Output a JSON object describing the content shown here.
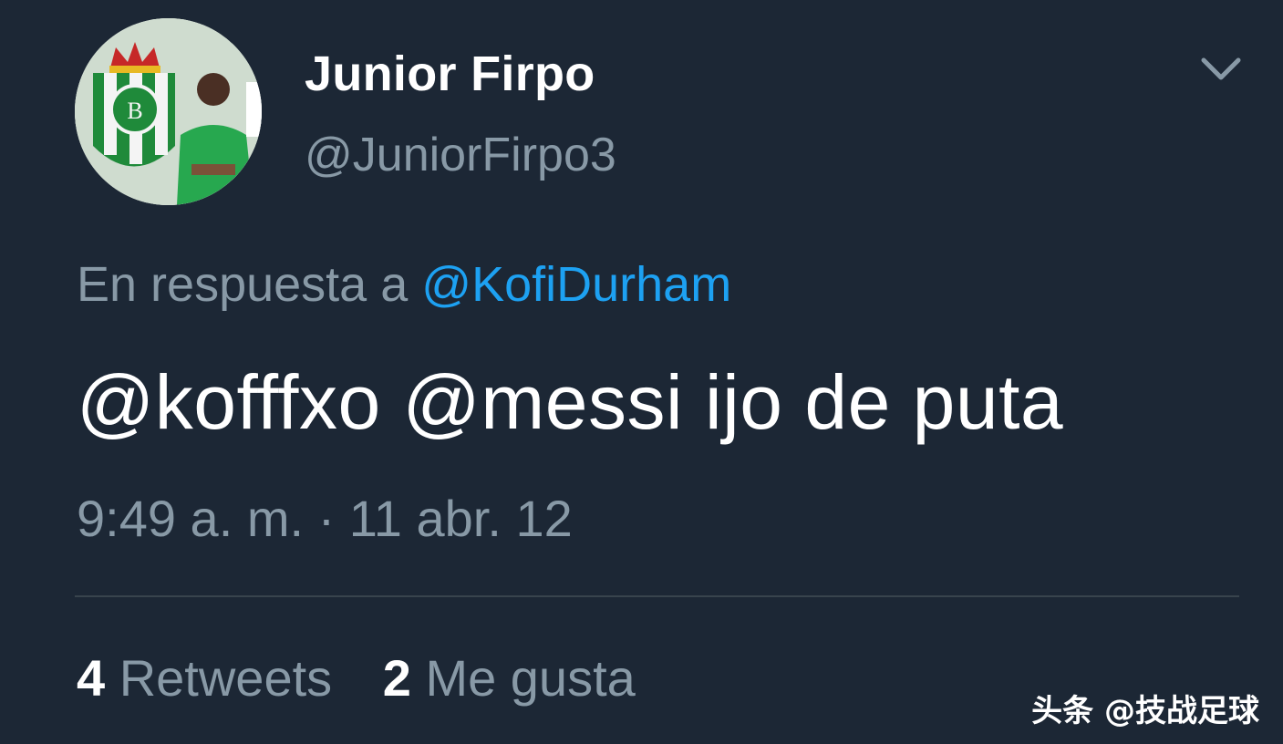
{
  "tweet": {
    "author": {
      "display_name": "Junior Firpo",
      "handle": "@JuniorFirpo3",
      "avatar_icon": "profile-photo-betis-crest"
    },
    "menu_icon": "chevron-down-icon",
    "reply_to": {
      "prefix": "En respuesta a",
      "mention": "@KofiDurham"
    },
    "text": "@kofffxo @messi ijo de puta",
    "timestamp": "9:49 a. m. · 11 abr. 12",
    "stats": {
      "retweets_count": "4",
      "retweets_label": "Retweets",
      "likes_count": "2",
      "likes_label": "Me gusta"
    }
  },
  "watermark": "头条 @技战足球",
  "colors": {
    "background": "#1c2735",
    "secondary_text": "#8899a6",
    "link": "#1da1f2",
    "primary_text": "#ffffff"
  }
}
